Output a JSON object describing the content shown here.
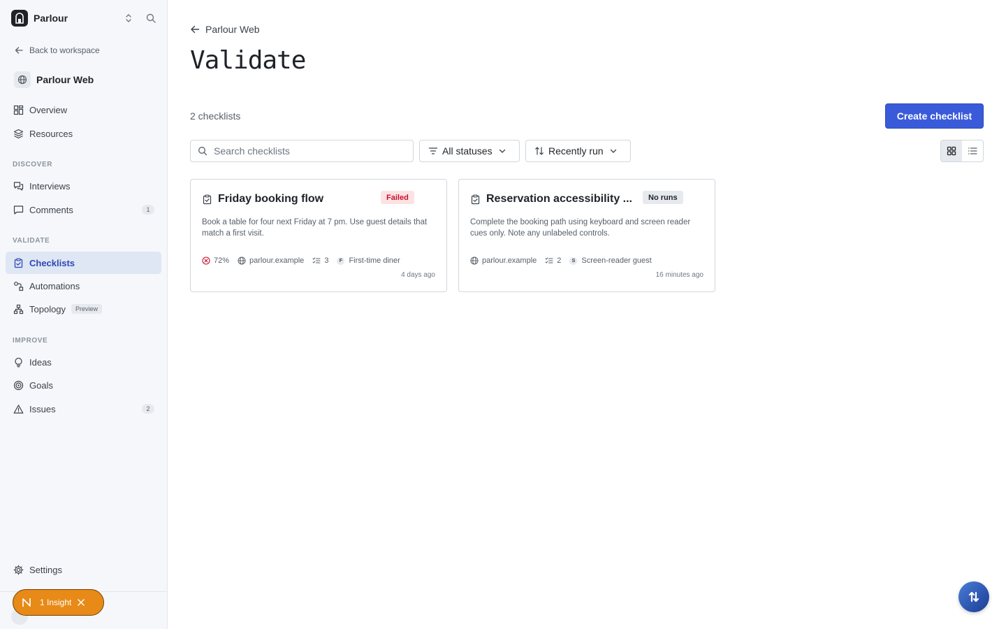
{
  "workspace": {
    "name": "Parlour"
  },
  "sidebar": {
    "back_label": "Back to workspace",
    "project_name": "Parlour Web",
    "top_items": [
      {
        "label": "Overview",
        "icon": "overview-grid-icon"
      },
      {
        "label": "Resources",
        "icon": "layers-icon"
      }
    ],
    "sections": [
      {
        "label": "DISCOVER"
      },
      {
        "label": "VALIDATE"
      },
      {
        "label": "IMPROVE"
      }
    ],
    "discover": [
      {
        "label": "Interviews",
        "icon": "chat-icon"
      },
      {
        "label": "Comments",
        "icon": "comment-icon",
        "count": "1"
      }
    ],
    "validate": [
      {
        "label": "Checklists",
        "icon": "clipboard-check-icon",
        "active": true
      },
      {
        "label": "Automations",
        "icon": "automation-icon"
      },
      {
        "label": "Topology",
        "icon": "topology-icon",
        "badge": "Preview"
      }
    ],
    "improve": [
      {
        "label": "Ideas",
        "icon": "lightbulb-icon"
      },
      {
        "label": "Goals",
        "icon": "target-icon"
      },
      {
        "label": "Issues",
        "icon": "warning-icon",
        "count": "2"
      }
    ],
    "settings_label": "Settings"
  },
  "insight": {
    "label": "1 Insight"
  },
  "main": {
    "breadcrumb": "Parlour Web",
    "title": "Validate",
    "count_text": "2 checklists",
    "create_label": "Create checklist",
    "search_placeholder": "Search checklists",
    "status_filter": "All statuses",
    "sort": "Recently run",
    "view_mode": "grid"
  },
  "checklists": [
    {
      "title": "Friday booking flow",
      "status": "Failed",
      "description": "Book a table for four next Friday at 7 pm. Use guest details that match a first visit.",
      "score": "72%",
      "domain": "parlour.example",
      "steps": "3",
      "persona_initial": "F",
      "persona": "First-time diner",
      "time": "4 days ago"
    },
    {
      "title": "Reservation accessibility ...",
      "status": "No runs",
      "description": "Complete the booking path using keyboard and screen reader cues only. Note any unlabeled controls.",
      "domain": "parlour.example",
      "steps": "2",
      "persona_initial": "S",
      "persona": "Screen-reader guest",
      "time": "16 minutes ago"
    }
  ],
  "colors": {
    "accent": "#3a5bd9",
    "active_nav_bg": "#dfe6f4",
    "failed_text": "#c8102e",
    "failed_bg": "#fde2e4",
    "insight_bg": "#e88a17"
  }
}
